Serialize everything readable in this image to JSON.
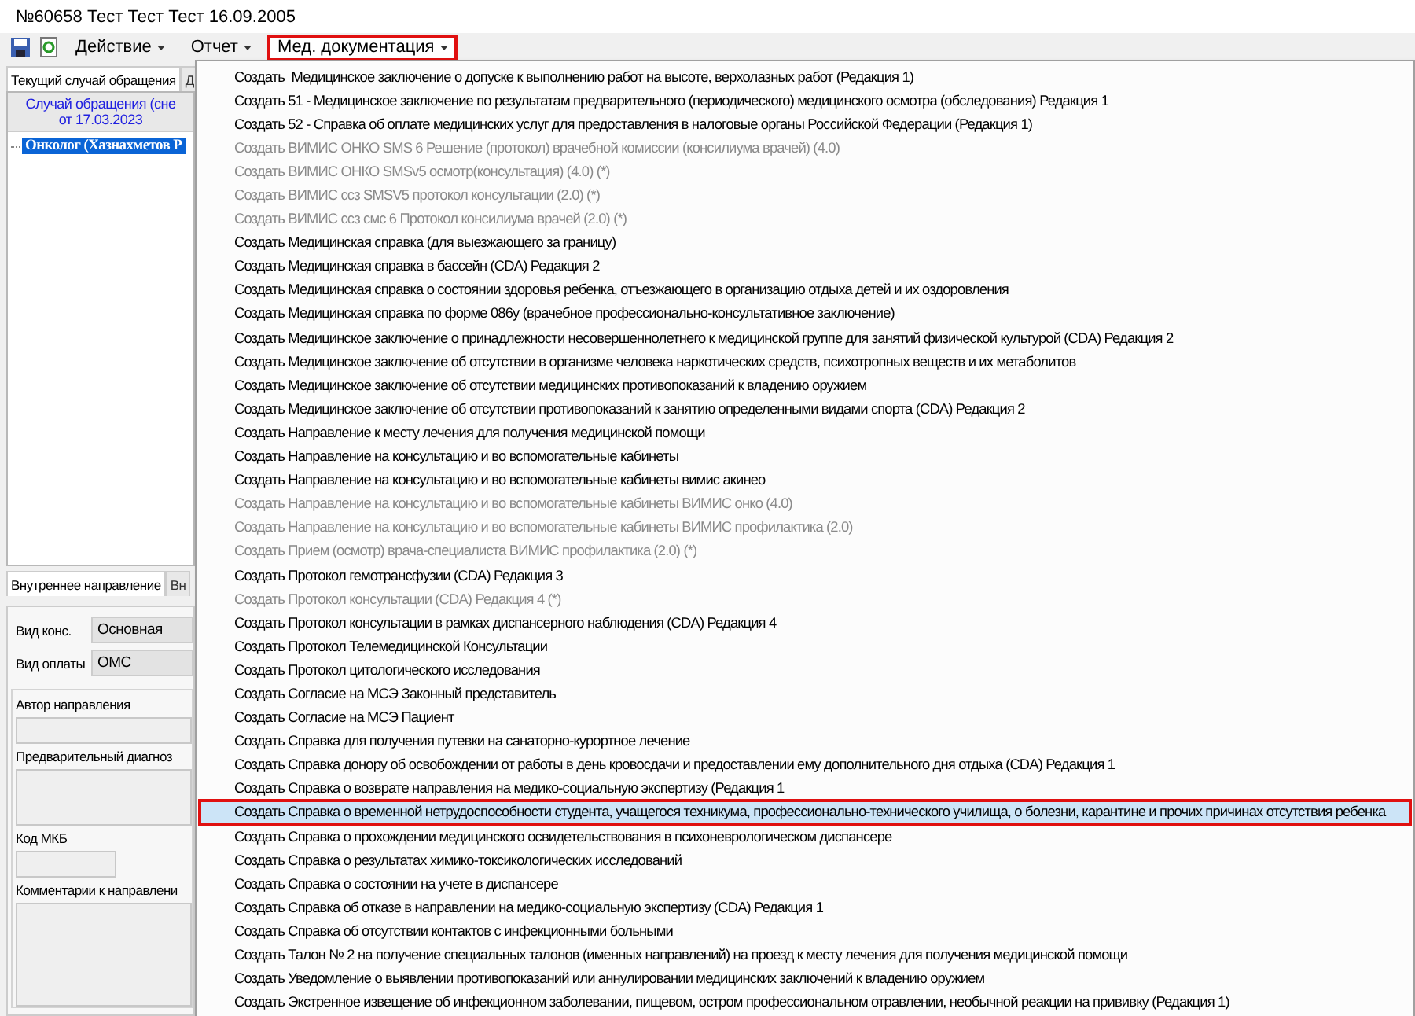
{
  "window": {
    "title": "№60658 Тест Тест Тест 16.09.2005"
  },
  "toolbar": {
    "menus": [
      {
        "label": "Действие",
        "selected": false
      },
      {
        "label": "Отчет",
        "selected": false
      },
      {
        "label": "Мед. документация",
        "selected": true
      }
    ]
  },
  "case_panel": {
    "tabs": [
      {
        "label": "Текущий случай обращения",
        "selected": true
      },
      {
        "label": "Д",
        "selected": false
      }
    ],
    "header": [
      "Случай обращения (сне",
      "от 17.03.2023"
    ],
    "tree": [
      {
        "label": "Онколог (Хазнахметов Р",
        "selected": true
      }
    ]
  },
  "direction_panel": {
    "tabs": [
      {
        "label": "Внутреннее направление",
        "selected": true
      },
      {
        "label": "Вн",
        "selected": false
      }
    ],
    "selects": [
      {
        "label": "Вид конс.",
        "value": "Основная"
      },
      {
        "label": "Вид оплаты",
        "value": "ОМС"
      }
    ],
    "fields": [
      {
        "label": "Автор направления",
        "kind": "input"
      },
      {
        "label": "Предварительный диагноз",
        "kind": "textarea"
      },
      {
        "label": "Код МКБ",
        "kind": "short"
      },
      {
        "label": "Комментарии к направлени",
        "kind": "textarea"
      }
    ]
  },
  "menu": {
    "items": [
      {
        "label": "Создать  Медицинское заключение о допуске к выполнению работ на высоте, верхолазных работ (Редакция 1)",
        "disabled": false,
        "selected": false
      },
      {
        "label": "Создать 51 - Медицинское заключение по результатам предварительного (периодического) медицинского осмотра (обследования) Редакция 1",
        "disabled": false,
        "selected": false
      },
      {
        "label": "Создать 52 - Справка об оплате медицинских услуг для предоставления в налоговые органы Российской Федерации (Редакция 1)",
        "disabled": false,
        "selected": false
      },
      {
        "label": "Создать ВИМИС ОНКО SMS 6 Решение (протокол) врачебной комиссии (консилиума врачей) (4.0)",
        "disabled": true,
        "selected": false
      },
      {
        "label": "Создать ВИМИС ОНКО SMSv5 осмотр(консультация) (4.0) (*)",
        "disabled": true,
        "selected": false
      },
      {
        "label": "Создать ВИМИС ссз SMSV5 протокол консультации (2.0) (*)",
        "disabled": true,
        "selected": false
      },
      {
        "label": "Создать ВИМИС ссз смс 6 Протокол консилиума врачей (2.0) (*)",
        "disabled": true,
        "selected": false
      },
      {
        "label": "Создать Медицинская справка (для выезжающего за границу)",
        "disabled": false,
        "selected": false
      },
      {
        "label": "Создать Медицинская справка в бассейн (CDA) Редакция 2",
        "disabled": false,
        "selected": false
      },
      {
        "label": "Создать Медицинская справка о состоянии здоровья ребенка, отъезжающего в организацию отдыха детей и их оздоровления",
        "disabled": false,
        "selected": false
      },
      {
        "label": "Создать Медицинская справка по форме 086у (врачебное профессионально-консультативное заключение)",
        "disabled": false,
        "selected": false
      },
      {
        "label": "Создать Медицинское заключение о принадлежности несовершеннолетнего к медицинской группе для занятий физической культурой (CDA) Редакция 2",
        "disabled": false,
        "selected": false
      },
      {
        "label": "Создать Медицинское заключение об отсутствии в организме человека наркотических средств, психотропных веществ и их метаболитов",
        "disabled": false,
        "selected": false
      },
      {
        "label": "Создать Медицинское заключение об отсутствии медицинских противопоказаний к владению оружием",
        "disabled": false,
        "selected": false
      },
      {
        "label": "Создать Медицинское заключение об отсутствии противопоказаний к занятию определенными видами спорта (CDA) Редакция 2",
        "disabled": false,
        "selected": false
      },
      {
        "label": "Создать Направление к месту лечения для получения медицинской помощи",
        "disabled": false,
        "selected": false
      },
      {
        "label": "Создать Направление на консультацию и во вспомогательные кабинеты",
        "disabled": false,
        "selected": false
      },
      {
        "label": "Создать Направление на консультацию и во вспомогательные кабинеты вимис акинео",
        "disabled": false,
        "selected": false
      },
      {
        "label": "Создать Направление на консультацию и во вспомогательные кабинеты ВИМИС онко (4.0)",
        "disabled": true,
        "selected": false
      },
      {
        "label": "Создать Направление на консультацию и во вспомогательные кабинеты ВИМИС профилактика (2.0)",
        "disabled": true,
        "selected": false
      },
      {
        "label": "Создать Прием (осмотр) врача-специалиста ВИМИС профилактика (2.0) (*)",
        "disabled": true,
        "selected": false
      },
      {
        "label": "Создать Протокол гемотрансфузии (CDA) Редакция 3",
        "disabled": false,
        "selected": false
      },
      {
        "label": "Создать Протокол консультации (CDA) Редакция 4 (*)",
        "disabled": true,
        "selected": false
      },
      {
        "label": "Создать Протокол консультации в рамках диспансерного наблюдения (CDA) Редакция 4",
        "disabled": false,
        "selected": false
      },
      {
        "label": "Создать Протокол Телемедицинской Консультации",
        "disabled": false,
        "selected": false
      },
      {
        "label": "Создать Протокол цитологического исследования",
        "disabled": false,
        "selected": false
      },
      {
        "label": "Создать Согласие на МСЭ Законный представитель",
        "disabled": false,
        "selected": false
      },
      {
        "label": "Создать Согласие на МСЭ Пациент",
        "disabled": false,
        "selected": false
      },
      {
        "label": "Создать Справка для получения путевки на санаторно-курортное лечение",
        "disabled": false,
        "selected": false
      },
      {
        "label": "Создать Справка донору об освобождении от работы в день кровосдачи и предоставлении ему дополнительного дня отдыха (CDA) Редакция 1",
        "disabled": false,
        "selected": false
      },
      {
        "label": "Создать Справка о возврате направления на медико-социальную экспертизу (Редакция 1",
        "disabled": false,
        "selected": false
      },
      {
        "label": "Создать Справка о временной нетрудоспособности студента, учащегося техникума, профессионально-технического училища, о болезни, карантине и прочих причинах отсутствия ребенка",
        "disabled": false,
        "selected": true
      },
      {
        "label": "Создать Справка о прохождении медицинского освидетельствования в психоневрологическом диспансере",
        "disabled": false,
        "selected": false
      },
      {
        "label": "Создать Справка о результатах химико-токсикологических исследований",
        "disabled": false,
        "selected": false
      },
      {
        "label": "Создать Справка о состоянии на учете в диспансере",
        "disabled": false,
        "selected": false
      },
      {
        "label": "Создать Справка об отказе в направлении на медико-социальную экспертизу (CDA) Редакция 1",
        "disabled": false,
        "selected": false
      },
      {
        "label": "Создать Справка об отсутствии контактов с инфекционными больными",
        "disabled": false,
        "selected": false
      },
      {
        "label": "Создать Талон № 2 на получение специальных талонов (именных направлений) на проезд к месту лечения для получения медицинской помощи",
        "disabled": false,
        "selected": false
      },
      {
        "label": "Создать Уведомление о выявлении противопоказаний или аннулировании медицинских заключений к владению оружием",
        "disabled": false,
        "selected": false
      },
      {
        "label": "Создать Экстренное извещение об инфекционном заболевании, пищевом, остром профессиональном отравлении, необычной реакции на прививку (Редакция 1)",
        "disabled": false,
        "selected": false
      }
    ]
  }
}
